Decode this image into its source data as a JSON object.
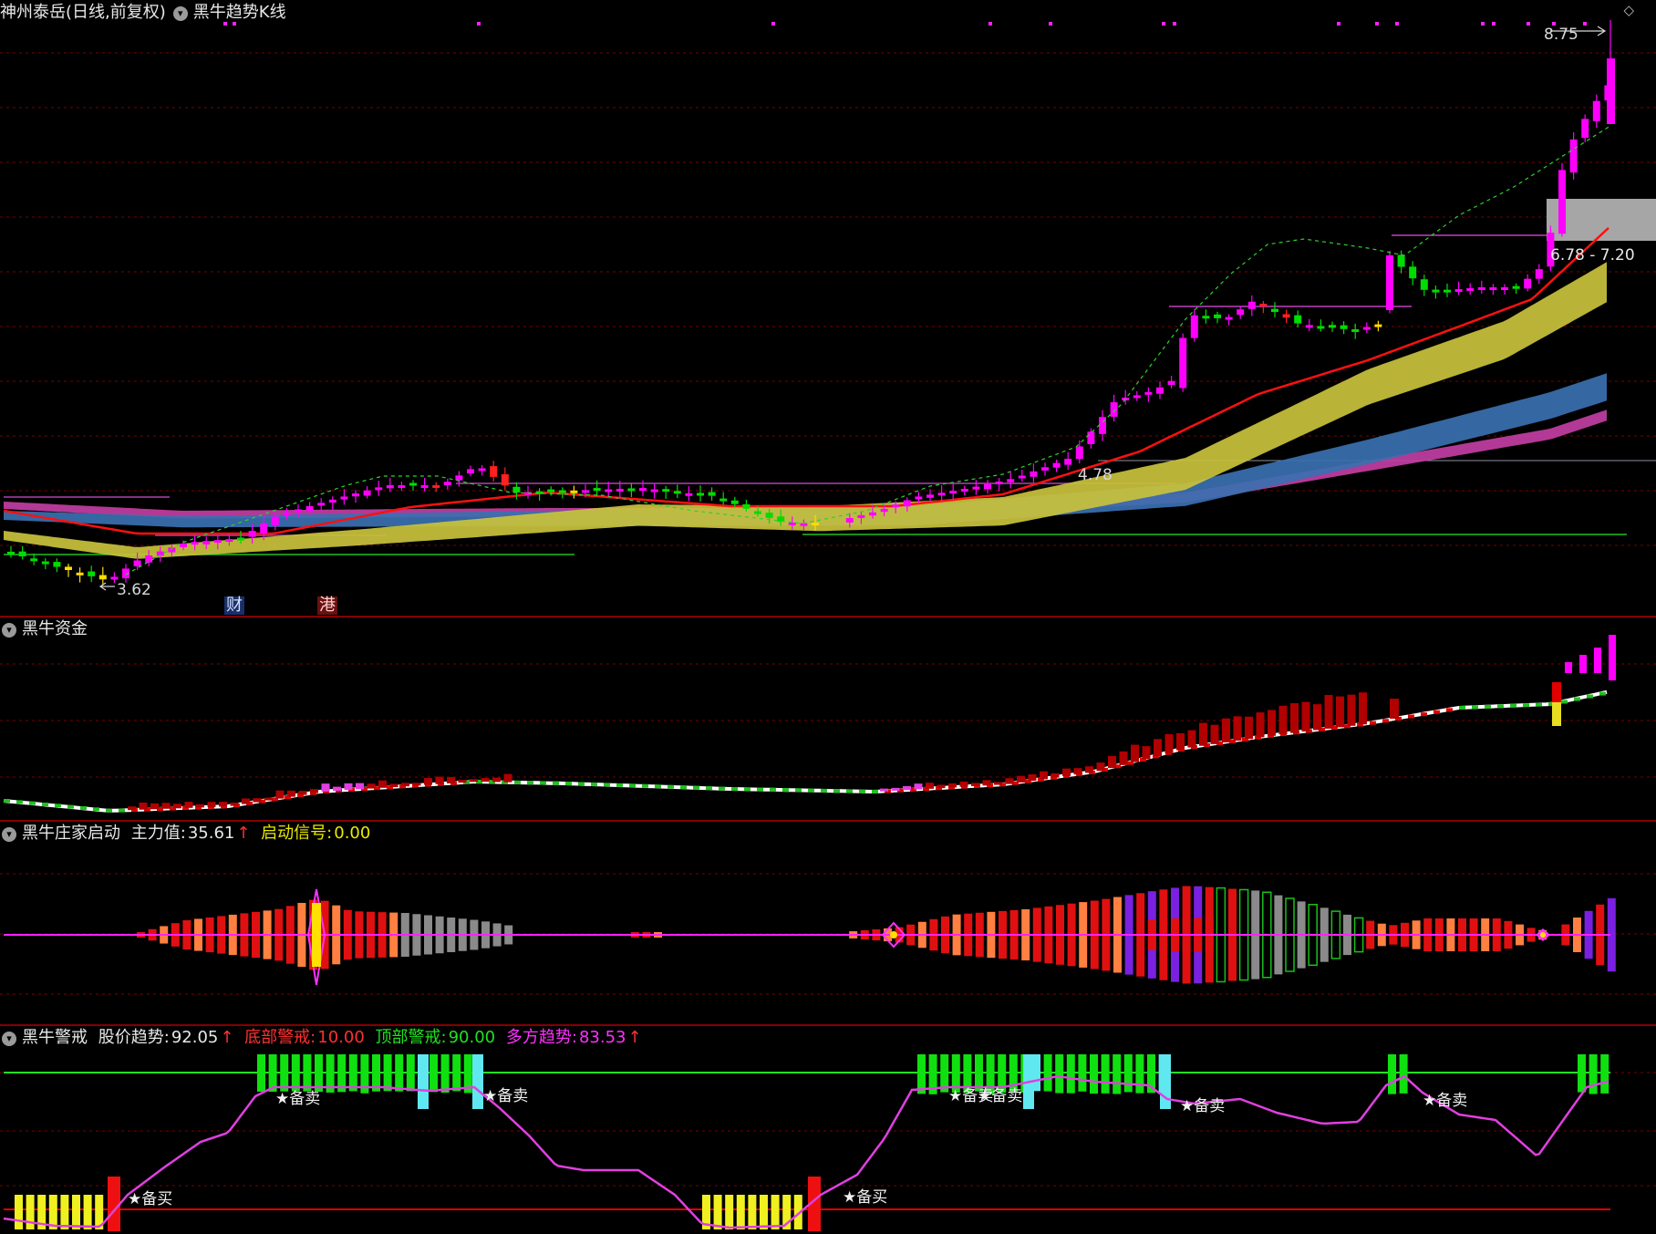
{
  "header": {
    "stock_name": "神州泰岳",
    "period": "(日线,前复权)",
    "indicator": "黑牛趋势K线"
  },
  "colors": {
    "bg": "#000000",
    "grid": "#7a0000",
    "up": "#ff00ff",
    "down": "#00dd00",
    "ma_red": "#ff1010",
    "band_gold": "#c9c23c",
    "band_blue": "#3a70b0",
    "band_pink": "#c23ea3"
  },
  "panel1": {
    "price_high_label": "8.75",
    "price_low_label": "3.62",
    "zone_label": "6.78 - 7.20",
    "support_label": "4.78",
    "badge_cai": "财",
    "badge_gang": "港"
  },
  "panel2": {
    "title": "黑牛资金"
  },
  "panel3": {
    "title": "黑牛庄家启动",
    "field1_label": "主力值:",
    "field1_value": "35.61",
    "field2_label": "启动信号:",
    "field2_value": "0.00"
  },
  "panel4": {
    "title": "黑牛警戒",
    "f1_label": "股价趋势:",
    "f1_value": "92.05",
    "f2_label": "底部警戒:",
    "f2_value": "10.00",
    "f3_label": "顶部警戒:",
    "f3_value": "90.00",
    "f4_label": "多方趋势:",
    "f4_value": "83.53",
    "buy_label": "★备买",
    "sell_label": "★备卖"
  },
  "chart_data": [
    {
      "type": "candlestick",
      "title": "黑牛趋势K线",
      "high": 8.75,
      "low": 3.62,
      "annotations": [
        "8.75",
        "3.62",
        "4.78",
        "6.78 - 7.20",
        "财",
        "港"
      ]
    },
    {
      "type": "bar",
      "title": "黑牛资金"
    },
    {
      "type": "bar",
      "title": "黑牛庄家启动",
      "主力值": 35.61,
      "启动信号": 0.0
    },
    {
      "type": "line",
      "title": "黑牛警戒",
      "series": [
        {
          "name": "股价趋势",
          "last": 92.05
        },
        {
          "name": "底部警戒",
          "last": 10.0
        },
        {
          "name": "顶部警戒",
          "last": 90.0
        },
        {
          "name": "多方趋势",
          "last": 83.53
        }
      ]
    }
  ]
}
